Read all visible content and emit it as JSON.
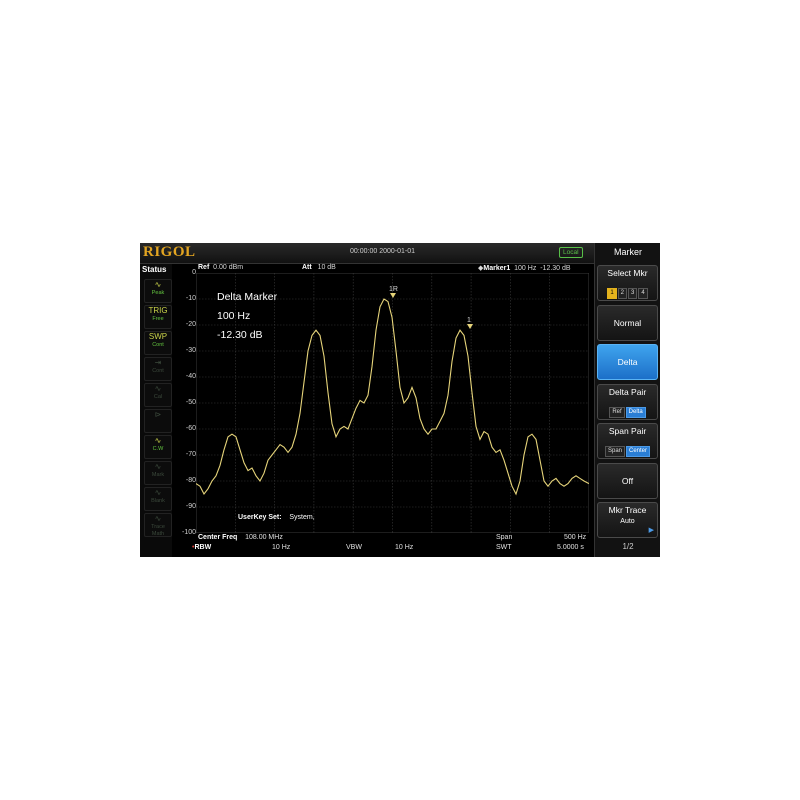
{
  "brand": "RIGOL",
  "datetime": "00:00:00 2000-01-01",
  "remote_state": "Local",
  "status": {
    "title": "Status",
    "icons": [
      {
        "name": "peak-icon",
        "glyph": "∿",
        "label": "Peak",
        "active": true
      },
      {
        "name": "trig-free-icon",
        "glyph": "TRIG",
        "label": "Free",
        "active": true
      },
      {
        "name": "sweep-cont-icon",
        "glyph": "SWP",
        "label": "Cont",
        "active": true
      },
      {
        "name": "cont-icon",
        "glyph": "⇥",
        "label": "Cont",
        "active": false
      },
      {
        "name": "calibration-icon",
        "glyph": "∿",
        "label": "Cal",
        "active": false
      },
      {
        "name": "tracking-icon",
        "glyph": "⊳",
        "label": "",
        "active": false
      },
      {
        "name": "clear-write-icon",
        "glyph": "∿",
        "label": "C.W",
        "active": true
      },
      {
        "name": "trace-mark-icon",
        "glyph": "∿",
        "label": "Mark",
        "active": false
      },
      {
        "name": "trace-blank-icon",
        "glyph": "∿",
        "label": "Blank",
        "active": false
      },
      {
        "name": "trace-math-icon",
        "glyph": "∿",
        "label": "Trace Math",
        "active": false
      }
    ]
  },
  "header": {
    "ref_label": "Ref",
    "ref_value": "0.00 dBm",
    "att_label": "Att",
    "att_value": "10 dB",
    "marker_label": "Marker1",
    "marker_freq": "100 Hz",
    "marker_amp": "-12.30 dB"
  },
  "y_axis": [
    "0",
    "-10",
    "-20",
    "-30",
    "-40",
    "-50",
    "-60",
    "-70",
    "-80",
    "-90",
    "-100"
  ],
  "delta": {
    "title": "Delta Marker",
    "freq": "100 Hz",
    "amp": "-12.30 dB"
  },
  "markers": {
    "ref_label": "1R",
    "delta_label": "1"
  },
  "userkey_label": "UserKey Set:",
  "userkey_value": "System,",
  "footer": {
    "center_label": "Center Freq",
    "center_value": "108.00 MHz",
    "span_label": "Span",
    "span_value": "500 Hz",
    "rbw_label": "RBW",
    "rbw_value": "10 Hz",
    "vbw_label": "VBW",
    "vbw_value": "10 Hz",
    "swt_label": "SWT",
    "swt_value": "5.0000 s"
  },
  "menu": {
    "title": "Marker",
    "select_mkr": "Select Mkr",
    "mkr_numbers": [
      "1",
      "2",
      "3",
      "4"
    ],
    "normal": "Normal",
    "delta": "Delta",
    "delta_pair": "Delta Pair",
    "delta_pair_opts": [
      "Ref",
      "Delta"
    ],
    "span_pair": "Span Pair",
    "span_pair_opts": [
      "Span",
      "Center"
    ],
    "off": "Off",
    "mkr_trace": "Mkr Trace",
    "mkr_trace_value": "Auto",
    "page": "1/2"
  },
  "colors": {
    "trace": "#e6d47a",
    "brand": "#e3a521",
    "active": "#1c6fc8",
    "local": "#58c048"
  }
}
